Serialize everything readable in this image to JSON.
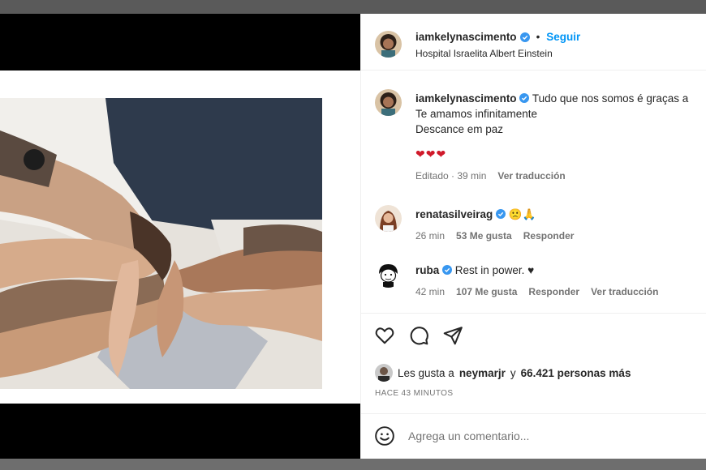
{
  "post": {
    "username": "iamkelynascimento",
    "follow_label": "Seguir",
    "separator": "•",
    "location": "Hospital Israelita Albert Einstein"
  },
  "caption": {
    "username": "iamkelynascimento",
    "line1": "Tudo que nos somos é graças a",
    "line2": "Te amamos infinitamente",
    "line3": "Descance em paz",
    "hearts": "❤❤❤",
    "edited": "Editado · 39 min",
    "translate": "Ver traducción"
  },
  "comments": [
    {
      "username": "renatasilveirag",
      "text": "🙁🙏",
      "time": "26 min",
      "likes": "53 Me gusta",
      "reply": "Responder"
    },
    {
      "username": "ruba",
      "text": "Rest in power. ♥",
      "time": "42 min",
      "likes": "107 Me gusta",
      "reply": "Responder",
      "translate": "Ver traducción"
    }
  ],
  "likes": {
    "prefix": "Les gusta a",
    "user": "neymarjr",
    "joiner": "y",
    "others": "66.421 personas más"
  },
  "timestamp": "HACE 43 MINUTOS",
  "add_comment": {
    "placeholder": "Agrega un comentario..."
  },
  "icons": [
    "verified-icon",
    "heart-icon",
    "comment-icon",
    "share-icon",
    "emoji-icon"
  ],
  "colors": {
    "accent": "#0095f6",
    "verified": "#3897f0",
    "text": "#262626",
    "muted": "#737373",
    "heart": "#d0192a"
  }
}
